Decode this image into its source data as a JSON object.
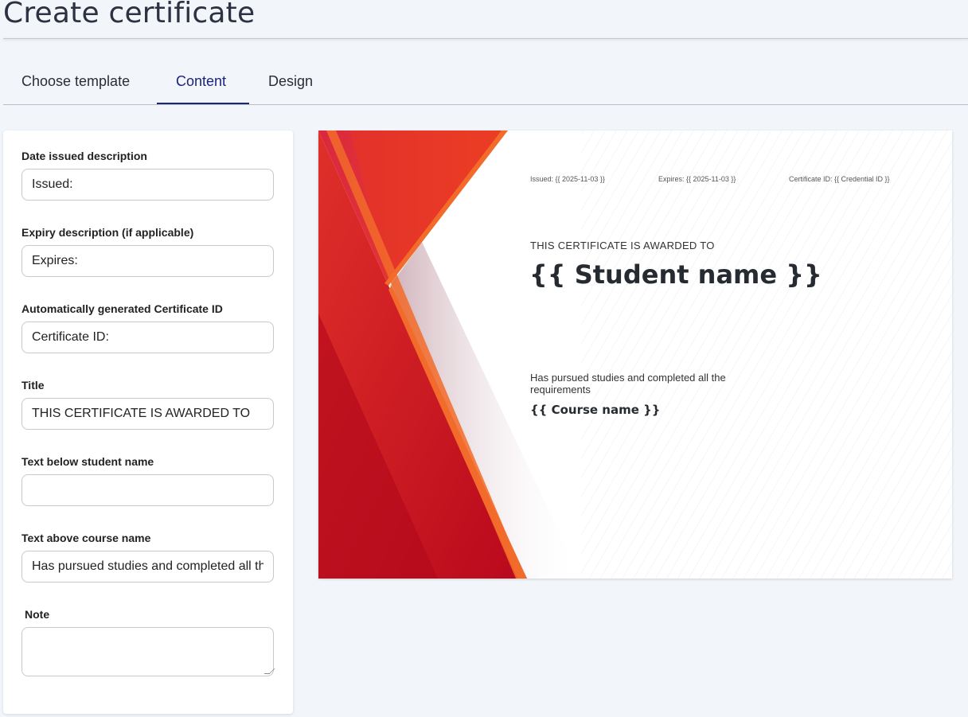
{
  "header": {
    "title": "Create certificate"
  },
  "tabs": [
    {
      "label": "Choose template"
    },
    {
      "label": "Content"
    },
    {
      "label": "Design"
    }
  ],
  "form": {
    "date_issued": {
      "label": "Date issued description",
      "value": "Issued:"
    },
    "expiry": {
      "label": "Expiry description (if applicable)",
      "value": "Expires:"
    },
    "cert_id": {
      "label": "Automatically generated Certificate ID",
      "value": "Certificate ID:"
    },
    "title": {
      "label": "Title",
      "value": "THIS CERTIFICATE IS AWARDED TO"
    },
    "below_student": {
      "label": "Text below student name",
      "value": ""
    },
    "above_course": {
      "label": "Text above course name",
      "value": "Has pursued studies and completed all the requirements"
    },
    "note": {
      "label": "Note",
      "value": ""
    }
  },
  "certificate": {
    "issued": "Issued: {{ 2025-11-03 }}",
    "expires": "Expires: {{ 2025-11-03 }}",
    "cert_id": "Certificate ID: {{ Credential ID }}",
    "title": "THIS CERTIFICATE IS AWARDED TO",
    "student": "{{ Student name }}",
    "above_course": "Has pursued studies and completed all the requirements",
    "course": "{{ Course name }}",
    "colors": {
      "accent_red": "#c8102e",
      "accent_orange": "#f26b2a"
    }
  }
}
